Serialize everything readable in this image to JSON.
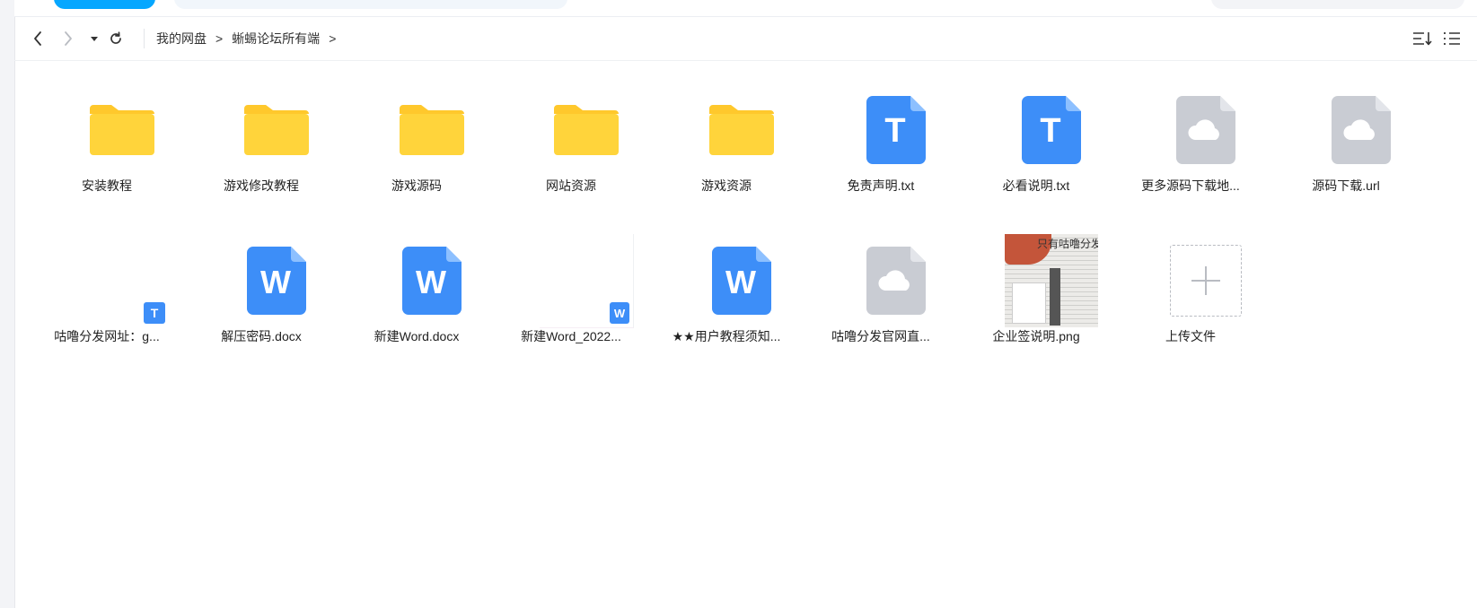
{
  "toolbar": {
    "breadcrumb": [
      "我的网盘",
      "蜥蜴论坛所有端"
    ],
    "crumb_sep": ">"
  },
  "files": [
    {
      "name": "安装教程",
      "icon": "folder-icon"
    },
    {
      "name": "游戏修改教程",
      "icon": "folder-icon"
    },
    {
      "name": "游戏源码",
      "icon": "folder-icon"
    },
    {
      "name": "网站资源",
      "icon": "folder-icon"
    },
    {
      "name": "游戏资源",
      "icon": "folder-icon"
    },
    {
      "name": "免责声明.txt",
      "icon": "txt-file-icon",
      "glyph": "T"
    },
    {
      "name": "必看说明.txt",
      "icon": "txt-file-icon",
      "glyph": "T"
    },
    {
      "name": "更多源码下载地...",
      "icon": "cloud-file-icon"
    },
    {
      "name": "源码下载.url",
      "icon": "cloud-file-icon"
    },
    {
      "name": "咕噜分发网址：g...",
      "icon": "txt-thumbnail-icon",
      "badge": "T"
    },
    {
      "name": "解压密码.docx",
      "icon": "word-file-icon",
      "glyph": "W"
    },
    {
      "name": "新建Word.docx",
      "icon": "word-file-icon",
      "glyph": "W"
    },
    {
      "name": "新建Word_2022...",
      "icon": "word-thumbnail-icon",
      "badge": "W"
    },
    {
      "name": "★★用户教程须知...",
      "icon": "word-file-icon",
      "glyph": "W"
    },
    {
      "name": "咕噜分发官网直...",
      "icon": "cloud-file-icon"
    },
    {
      "name": "企业签说明.png",
      "icon": "image-thumbnail-icon",
      "caption": "只有咕噜分发"
    },
    {
      "name": "上传文件",
      "icon": "upload-plus-icon"
    }
  ],
  "colors": {
    "folder": "#ffd43b",
    "folder_tab": "#ffc82c",
    "blue_doc": "#3d8ef8",
    "gray_doc": "#c9ccd3",
    "accent": "#06a7ff"
  }
}
